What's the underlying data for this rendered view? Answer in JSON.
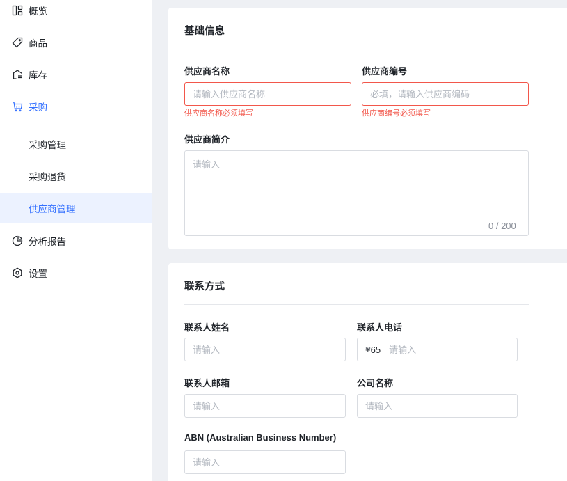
{
  "sidebar": {
    "items": [
      {
        "label": "概览",
        "icon": "dashboard-icon"
      },
      {
        "label": "商品",
        "icon": "tag-icon"
      },
      {
        "label": "库存",
        "icon": "warehouse-icon"
      },
      {
        "label": "采购",
        "icon": "cart-icon"
      },
      {
        "label": "采购管理"
      },
      {
        "label": "采购退货"
      },
      {
        "label": "供应商管理"
      },
      {
        "label": "分析报告",
        "icon": "pie-chart-icon"
      },
      {
        "label": "设置",
        "icon": "settings-icon"
      }
    ],
    "active_color": "#3370ff",
    "selected_bg": "#ecf2ff"
  },
  "basic_info": {
    "title": "基础信息",
    "supplier_name": {
      "label": "供应商名称",
      "placeholder": "请输入供应商名称",
      "error": "供应商名称必须填写"
    },
    "supplier_code": {
      "label": "供应商编号",
      "placeholder": "必填，请输入供应商编码",
      "error": "供应商编号必须填写"
    },
    "description": {
      "label": "供应商简介",
      "placeholder": "请输入",
      "counter": "0 / 200"
    }
  },
  "contact": {
    "title": "联系方式",
    "contact_name": {
      "label": "联系人姓名",
      "placeholder": "请输入"
    },
    "contact_phone": {
      "label": "联系人电话",
      "country_code": "+65",
      "placeholder": "请输入"
    },
    "contact_email": {
      "label": "联系人邮箱",
      "placeholder": "请输入"
    },
    "company_name": {
      "label": "公司名称",
      "placeholder": "请输入"
    },
    "abn": {
      "label": "ABN (Australian Business Number)",
      "placeholder": "请输入"
    }
  },
  "colors": {
    "error": "#f2574b",
    "primary": "#3370ff"
  }
}
